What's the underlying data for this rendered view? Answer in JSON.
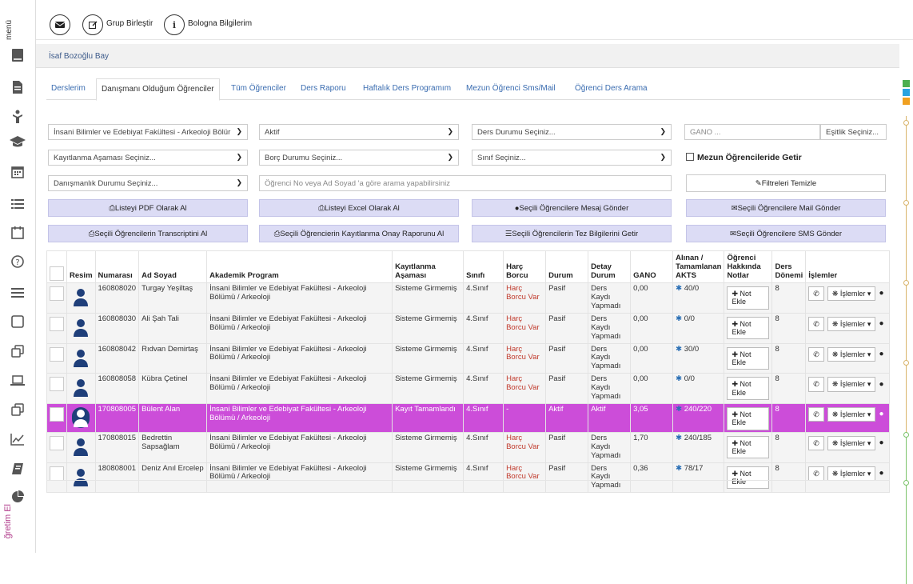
{
  "sidebar": {
    "menu_label": "menü",
    "bottom_label": "ğretim El",
    "icons": [
      "book-icon",
      "document-icon",
      "child-icon",
      "graduation-cap-icon",
      "calendar-icon",
      "list-icon",
      "calendar-empty-icon",
      "question-circle-icon",
      "bars-icon",
      "square-icon",
      "clone-icon",
      "laptop-icon",
      "clone-icon",
      "line-chart-icon",
      "bookmark-icon",
      "pie-chart-icon"
    ]
  },
  "toolbar": {
    "group_merge": "Grup Birleştir",
    "bologna": "Bologna Bilgilerim"
  },
  "user": {
    "name": "İsaf Bozoğlu Bay"
  },
  "tabs": [
    {
      "label": "Derslerim"
    },
    {
      "label": "Danışmanı Olduğum Öğrenciler"
    },
    {
      "label": "Tüm Öğrenciler"
    },
    {
      "label": "Ders Raporu"
    },
    {
      "label": "Haftalık Ders Programım"
    },
    {
      "label": "Mezun Öğrenci Sms/Mail"
    },
    {
      "label": "Öğrenci Ders Arama"
    }
  ],
  "filters": {
    "faculty": "İnsani Bilimler ve Edebiyat Fakültesi - Arkeoloji Bölür",
    "status": "Aktif",
    "course_status": "Ders Durumu Seçiniz...",
    "gano_placeholder": "GANO ...",
    "equality": "Eşitlik Seçiniz...",
    "registration_stage": "Kayıtlanma Aşaması Seçiniz...",
    "debt_status": "Borç Durumu Seçiniz...",
    "class": "Sınıf Seçiniz...",
    "graduates_label": "Mezun Öğrencileride Getir",
    "advisory_status": "Danışmanlık Durumu Seçiniz...",
    "search_placeholder": "Öğrenci No veya Ad Soyad 'a göre arama yapabilirsiniz",
    "clear_filters": "Filtreleri Temizle"
  },
  "actions": {
    "pdf": "Listeyi PDF Olarak Al",
    "excel": "Listeyi Excel Olarak Al",
    "message": "Seçili Öğrencilere Mesaj Gönder",
    "mail": "Seçili Öğrencilere Mail Gönder",
    "transcript": "Seçili Öğrencilerin Transcriptini Al",
    "registration_report": "Seçili Öğrencierin Kayıtlanma Onay Raporunu Al",
    "thesis": "Seçili Öğrencilerin Tez Bilgilerini Getir",
    "sms": "Seçili Öğrencilere SMS Gönder"
  },
  "table": {
    "headers": {
      "photo": "Resim",
      "number": "Numarası",
      "name": "Ad Soyad",
      "program": "Akademik Program",
      "stage": "Kayıtlanma Aşaması",
      "class": "Sınıfı",
      "fee": "Harç Borcu",
      "status": "Durum",
      "detail": "Detay Durum",
      "gano": "GANO",
      "akts": "Alınan / Tamamlanan AKTS",
      "notes": "Öğrenci Hakkında Notlar",
      "term": "Ders Dönemi",
      "ops": "İşlemler"
    },
    "note_button": "Not Ekle",
    "ops_button": "İşlemler",
    "rows": [
      {
        "number": "160808020",
        "name": "Turgay Yeşiltaş",
        "program": "İnsani Bilimler ve Edebiyat Fakültesi - Arkeoloji Bölümü / Arkeoloji",
        "stage": "Sisteme Girmemiş",
        "class": "4.Sınıf",
        "fee": "Harç Borcu Var",
        "status": "Pasif",
        "detail": "Ders Kaydı Yapmadı",
        "gano": "0,00",
        "akts": "40/0",
        "term": "8"
      },
      {
        "number": "160808030",
        "name": "Ali Şah Tali",
        "program": "İnsani Bilimler ve Edebiyat Fakültesi - Arkeoloji Bölümü / Arkeoloji",
        "stage": "Sisteme Girmemiş",
        "class": "4.Sınıf",
        "fee": "Harç Borcu Var",
        "status": "Pasif",
        "detail": "Ders Kaydı Yapmadı",
        "gano": "0,00",
        "akts": "0/0",
        "term": "8"
      },
      {
        "number": "160808042",
        "name": "Rıdvan Demirtaş",
        "program": "İnsani Bilimler ve Edebiyat Fakültesi - Arkeoloji Bölümü / Arkeoloji",
        "stage": "Sisteme Girmemiş",
        "class": "4.Sınıf",
        "fee": "Harç Borcu Var",
        "status": "Pasif",
        "detail": "Ders Kaydı Yapmadı",
        "gano": "0,00",
        "akts": "30/0",
        "term": "8"
      },
      {
        "number": "160808058",
        "name": "Kübra Çetinel",
        "program": "İnsani Bilimler ve Edebiyat Fakültesi - Arkeoloji Bölümü / Arkeoloji",
        "stage": "Sisteme Girmemiş",
        "class": "4.Sınıf",
        "fee": "Harç Borcu Var",
        "status": "Pasif",
        "detail": "Ders Kaydı Yapmadı",
        "gano": "0,00",
        "akts": "0/0",
        "term": "8"
      },
      {
        "number": "170808005",
        "name": "Bülent Alan",
        "program": "İnsani Bilimler ve Edebiyat Fakültesi - Arkeoloji Bölümü / Arkeoloji",
        "stage": "Kayıt Tamamlandı",
        "class": "4.Sınıf",
        "fee": "-",
        "status": "Aktif",
        "detail": "Aktif",
        "gano": "3,05",
        "akts": "240/220",
        "term": "8"
      },
      {
        "number": "170808015",
        "name": "Bedrettin Sapsağlam",
        "program": "İnsani Bilimler ve Edebiyat Fakültesi - Arkeoloji Bölümü / Arkeoloji",
        "stage": "Sisteme Girmemiş",
        "class": "4.Sınıf",
        "fee": "Harç Borcu Var",
        "status": "Pasif",
        "detail": "Ders Kaydı Yapmadı",
        "gano": "1,70",
        "akts": "240/185",
        "term": "8"
      },
      {
        "number": "180808001",
        "name": "Deniz Anıl Ercelep",
        "program": "İnsani Bilimler ve Edebiyat Fakültesi - Arkeoloji Bölümü / Arkeoloji",
        "stage": "Sisteme Girmemiş",
        "class": "4.Sınıf",
        "fee": "Harç Borcu Var",
        "status": "Pasif",
        "detail": "Ders Kaydı Yapmadı",
        "gano": "0,36",
        "akts": "78/17",
        "term": "8"
      }
    ]
  },
  "colors": {
    "highlight_row": "#cc4dd9",
    "accent_blue": "#3a6cb0",
    "rail_green": "#4caf50",
    "rail_blue": "#29a3e0",
    "rail_orange": "#f0a020"
  }
}
